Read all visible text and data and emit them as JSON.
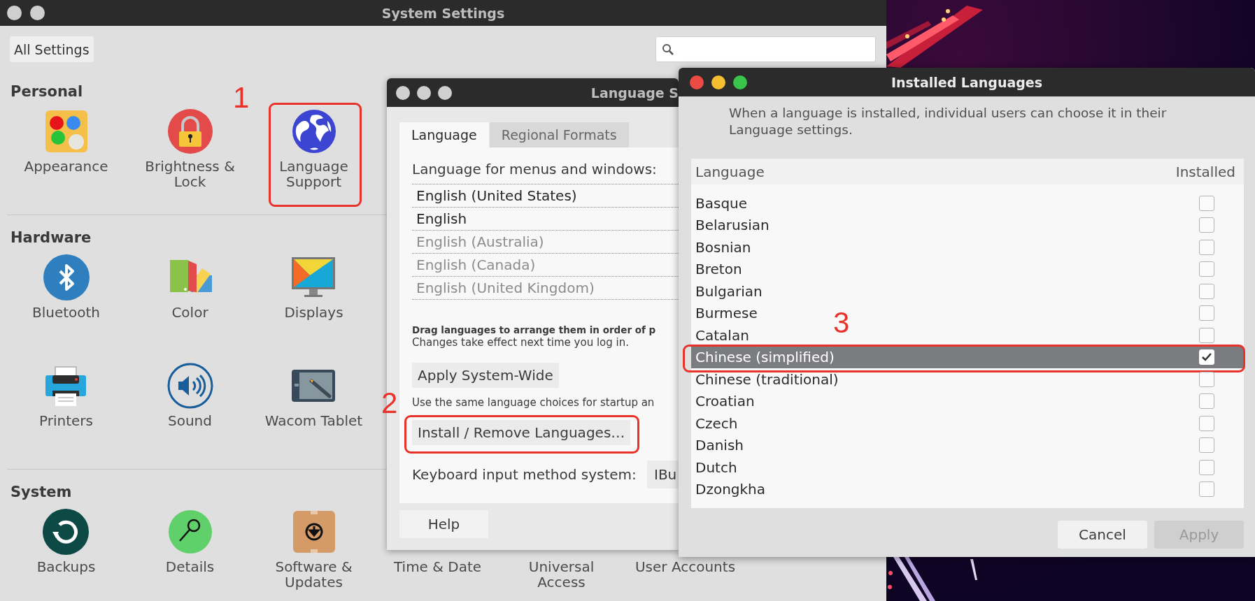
{
  "system_settings": {
    "title": "System Settings",
    "active": false,
    "all_settings_button": "All Settings",
    "sections": [
      {
        "heading": "Personal",
        "rows": [
          [
            {
              "label": "Appearance",
              "kind": "appearance"
            },
            {
              "label": "Brightness & Lock",
              "kind": "lock"
            },
            {
              "label": "Language Support",
              "kind": "globe",
              "annotation": "1"
            }
          ]
        ]
      },
      {
        "heading": "Hardware",
        "rows": [
          [
            {
              "label": "Bluetooth",
              "kind": "bluetooth"
            },
            {
              "label": "Color",
              "kind": "color"
            },
            {
              "label": "Displays",
              "kind": "display"
            }
          ],
          [
            {
              "label": "Printers",
              "kind": "printer"
            },
            {
              "label": "Sound",
              "kind": "sound"
            },
            {
              "label": "Wacom Tablet",
              "kind": "tablet"
            }
          ]
        ]
      },
      {
        "heading": "System",
        "rows": [
          [
            {
              "label": "Backups",
              "kind": "backup"
            },
            {
              "label": "Details",
              "kind": "details"
            },
            {
              "label": "Software & Updates",
              "kind": "package"
            },
            {
              "label": "Time & Date"
            },
            {
              "label": "Universal Access"
            },
            {
              "label": "User Accounts"
            }
          ]
        ]
      }
    ]
  },
  "language_support": {
    "title": "Language S",
    "active": false,
    "tabs": [
      {
        "label": "Language",
        "selected": true
      },
      {
        "label": "Regional Formats",
        "selected": false
      }
    ],
    "list_label": "Language for menus and windows:",
    "languages": [
      {
        "name": "English (United States)",
        "disabled": false
      },
      {
        "name": "English",
        "disabled": false
      },
      {
        "name": "English (Australia)",
        "disabled": true
      },
      {
        "name": "English (Canada)",
        "disabled": true
      },
      {
        "name": "English (United Kingdom)",
        "disabled": true
      }
    ],
    "drag_hint": "Drag languages to arrange them in order of p",
    "note": "Changes take effect next time you log in.",
    "apply_button": "Apply System-Wide",
    "apply_note": "Use the same language choices for startup an",
    "install_button": {
      "label": "Install / Remove Languages…",
      "annotation": "2"
    },
    "keyboard_label": "Keyboard input method system:",
    "keyboard_value": "IBu",
    "help_button": "Help"
  },
  "installed_languages": {
    "title": "Installed Languages",
    "active": true,
    "description": "When a language is installed, individual users can choose it in their Language settings.",
    "columns": [
      "Language",
      "Installed"
    ],
    "rows": [
      {
        "name": "Basque",
        "installed": false,
        "selected": false
      },
      {
        "name": "Belarusian",
        "installed": false,
        "selected": false
      },
      {
        "name": "Bosnian",
        "installed": false,
        "selected": false
      },
      {
        "name": "Breton",
        "installed": false,
        "selected": false
      },
      {
        "name": "Bulgarian",
        "installed": false,
        "selected": false
      },
      {
        "name": "Burmese",
        "installed": false,
        "selected": false
      },
      {
        "name": "Catalan",
        "installed": false,
        "selected": false
      },
      {
        "name": "Chinese (simplified)",
        "installed": true,
        "selected": true,
        "annotation": "3"
      },
      {
        "name": "Chinese (traditional)",
        "installed": false,
        "selected": false
      },
      {
        "name": "Croatian",
        "installed": false,
        "selected": false
      },
      {
        "name": "Czech",
        "installed": false,
        "selected": false
      },
      {
        "name": "Danish",
        "installed": false,
        "selected": false
      },
      {
        "name": "Dutch",
        "installed": false,
        "selected": false
      },
      {
        "name": "Dzongkha",
        "installed": false,
        "selected": false
      }
    ],
    "buttons": [
      {
        "label": "Cancel",
        "disabled": false
      },
      {
        "label": "Apply",
        "disabled": true
      }
    ]
  }
}
